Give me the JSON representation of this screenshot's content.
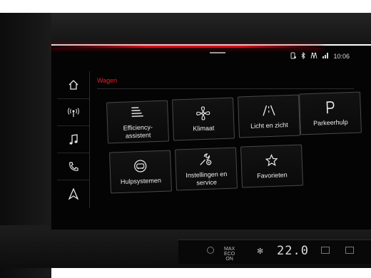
{
  "status_bar": {
    "icons": [
      "phone-link-icon",
      "bluetooth-icon",
      "passenger-icon",
      "signal-bars-icon"
    ],
    "time": "10:06"
  },
  "sidebar": {
    "items": [
      {
        "icon": "home-icon"
      },
      {
        "icon": "radio-icon"
      },
      {
        "icon": "music-note-icon"
      },
      {
        "icon": "phone-icon"
      },
      {
        "icon": "navigation-icon"
      }
    ]
  },
  "main": {
    "title": "Wagen",
    "tiles": [
      {
        "icon": "efficiency-icon",
        "label": "Efficiency-\nassistent"
      },
      {
        "icon": "fan-icon",
        "label": "Klimaat"
      },
      {
        "icon": "road-lights-icon",
        "label": "Licht en zicht"
      },
      {
        "icon": "parking-icon",
        "label": "Parkeerhulp"
      },
      {
        "icon": "assist-systems-icon",
        "label": "Hulpsystemen"
      },
      {
        "icon": "wrench-gear-icon",
        "label": "Instellingen en\nservice"
      },
      {
        "icon": "star-icon",
        "label": "Favorieten"
      }
    ]
  },
  "climate": {
    "mode_text": "MAX\nECO\nON",
    "temperature": "22.0"
  },
  "colors": {
    "accent": "#e0202a",
    "screen_bg": "#040404",
    "tile_border": "#4a4a4a"
  }
}
